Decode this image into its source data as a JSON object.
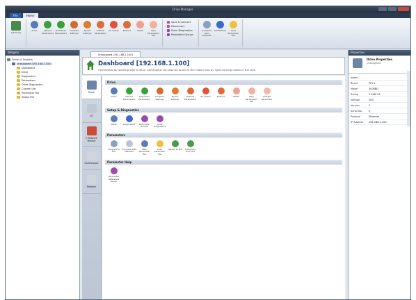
{
  "window": {
    "title": "Drive Manager",
    "ribbon_tabs": [
      "File",
      "Home"
    ]
  },
  "ribbon": {
    "groups": [
      {
        "buttons": [
          {
            "label": "Add Drive",
            "icon": "add-drive-icon",
            "color": "#4a8a4a"
          }
        ]
      },
      {
        "buttons": [
          {
            "label": "Drive",
            "icon": "drive-icon",
            "color": "#5a7db5"
          },
          {
            "label": "Upload Parameters",
            "icon": "upload-icon",
            "color": "#3aa03a"
          },
          {
            "label": "Download Parameters",
            "icon": "download-icon",
            "color": "#3aa03a"
          },
          {
            "label": "Compare Settings",
            "icon": "compare-icon",
            "color": "#d36a2a"
          },
          {
            "label": "Re-init Settings",
            "icon": "reinit-icon",
            "color": "#e07a30"
          },
          {
            "label": "Default Parameters",
            "icon": "default-icon",
            "color": "#e06b3a"
          },
          {
            "label": "Go Online",
            "icon": "go-online-icon",
            "color": "#e0543a"
          },
          {
            "label": "Restore",
            "icon": "restore-icon",
            "color": "#e06b3a"
          },
          {
            "label": "Reset",
            "icon": "reset-icon",
            "color": "#f0a090"
          },
          {
            "label": "New Parameters File",
            "icon": "new-file-icon",
            "color": "#f1b19a"
          }
        ]
      },
      {
        "list": [
          {
            "label": "Save & Connect",
            "color": "#c04a9a"
          },
          {
            "label": "Disconnect",
            "color": "#c04a9a"
          },
          {
            "label": "Drive Diagnostics",
            "color": "#8a4ab0"
          },
          {
            "label": "Parameter Groups",
            "color": "#8a4ab0"
          }
        ]
      },
      {
        "buttons": [
          {
            "label": "Compare with Defaults",
            "icon": "compare-defaults-icon",
            "color": "#8aa0c0"
          },
          {
            "label": "Set Default",
            "icon": "set-default-icon",
            "color": "#3a6ad0"
          },
          {
            "label": "Load Parameter File",
            "icon": "load-file-icon",
            "color": "#f0c040"
          }
        ]
      }
    ]
  },
  "left_panel": {
    "title": "Widgets",
    "tree": [
      {
        "label": "Drives & Projects",
        "depth": 0,
        "color": "#5a8a5a",
        "selected": false
      },
      {
        "label": "Unassigned (192.168.1.100)",
        "depth": 1,
        "color": "#4a6aa0",
        "selected": true
      },
      {
        "label": "Dashboard",
        "depth": 2,
        "color": "#e0b440",
        "selected": false
      },
      {
        "label": "Drive",
        "depth": 2,
        "color": "#e0b440",
        "selected": false
      },
      {
        "label": "Diagnostics",
        "depth": 2,
        "color": "#e0b440",
        "selected": false
      },
      {
        "label": "Parameters",
        "depth": 2,
        "color": "#e0b440",
        "selected": false
      },
      {
        "label": "Drive Diagnostics",
        "depth": 2,
        "color": "#e0b440",
        "selected": false
      },
      {
        "label": "Custom List",
        "depth": 2,
        "color": "#e0b440",
        "selected": false
      },
      {
        "label": "Parameter File",
        "depth": 2,
        "color": "#e0b440",
        "selected": false
      },
      {
        "label": "Status File",
        "depth": 2,
        "color": "#e0b440",
        "selected": false
      }
    ]
  },
  "center": {
    "doc_tab": "Unassigned (192.168.1.100)",
    "title": "Dashboard [192.168.1.100]",
    "subtitle": "Commands for working with a drive. Commands can also be found in the ribbon and by right-clicking nodes in the tree.",
    "nav": [
      {
        "label": "Drive",
        "color": "#6b85a8",
        "active": true
      },
      {
        "label": "I/O",
        "color": "#c0c8d4",
        "active": false
      },
      {
        "label": "C Network Monitor",
        "color": "#cc4a3a",
        "active": false
      },
      {
        "label": "Oscilloscope",
        "color": "#d0d6de",
        "active": false
      },
      {
        "label": "Network",
        "color": "#d0d6de",
        "active": false
      }
    ],
    "sections": [
      {
        "title": "Drive",
        "actions": [
          {
            "label": "Drive",
            "color": "#5a7db5"
          },
          {
            "label": "Upload Parameters",
            "color": "#3aa03a"
          },
          {
            "label": "Download Parameters",
            "color": "#3aa03a"
          },
          {
            "label": "Compare Settings",
            "color": "#d36a2a"
          },
          {
            "label": "Re-init Settings",
            "color": "#e07a30"
          },
          {
            "label": "Default Parameters",
            "color": "#e06b3a"
          },
          {
            "label": "Go Online",
            "color": "#e0543a"
          },
          {
            "label": "Restore",
            "color": "#e06b3a"
          },
          {
            "label": "Reset",
            "color": "#f0a090"
          },
          {
            "label": "New Parameters File",
            "color": "#f1b19a"
          },
          {
            "label": "Change Parameter",
            "color": "#f2b8a4"
          }
        ]
      },
      {
        "title": "Setup & Diagnostics",
        "actions": [
          {
            "label": "Setup",
            "color": "#5a7db5"
          },
          {
            "label": "Diagnostics",
            "color": "#3a6ad0"
          },
          {
            "label": "Parameter Groups",
            "color": "#9a4ab5"
          },
          {
            "label": "Drive Diagnostics",
            "color": "#9a4ab5"
          }
        ]
      },
      {
        "title": "Parameters",
        "actions": [
          {
            "label": "Compare to File",
            "color": "#8aa0c0"
          },
          {
            "label": "Compare with Defaults",
            "color": "#b8c4d4"
          },
          {
            "label": "New parameter file",
            "color": "#5a7db5"
          },
          {
            "label": "Load parameter file",
            "color": "#f0c040"
          },
          {
            "label": "Upload to File",
            "color": "#4a9a4a"
          },
          {
            "label": "Download from File",
            "color": "#4a9a4a"
          }
        ]
      },
      {
        "title": "Parameter Help",
        "actions": [
          {
            "label": "Parameter Reference Guide",
            "color": "#a04ab0"
          }
        ]
      }
    ]
  },
  "right_panel": {
    "title": "Properties",
    "heading": "Drive Properties",
    "subheading": "Unassigned",
    "rows": [
      {
        "k": "Name",
        "v": ""
      },
      {
        "k": "Brand",
        "v": "PE+x"
      },
      {
        "k": "Model",
        "v": "3000BG"
      },
      {
        "k": "Rating",
        "v": "2.5kW 2A"
      },
      {
        "k": "Voltage",
        "v": "200"
      },
      {
        "k": "Version",
        "v": "1"
      },
      {
        "k": "Serial No.",
        "v": "0"
      },
      {
        "k": "Protocol",
        "v": "Ethernet"
      },
      {
        "k": "IP Address",
        "v": "192.168.1.100"
      }
    ]
  },
  "colors": {
    "accent": "#1d3f7a",
    "frame": "#2d3a4d"
  }
}
